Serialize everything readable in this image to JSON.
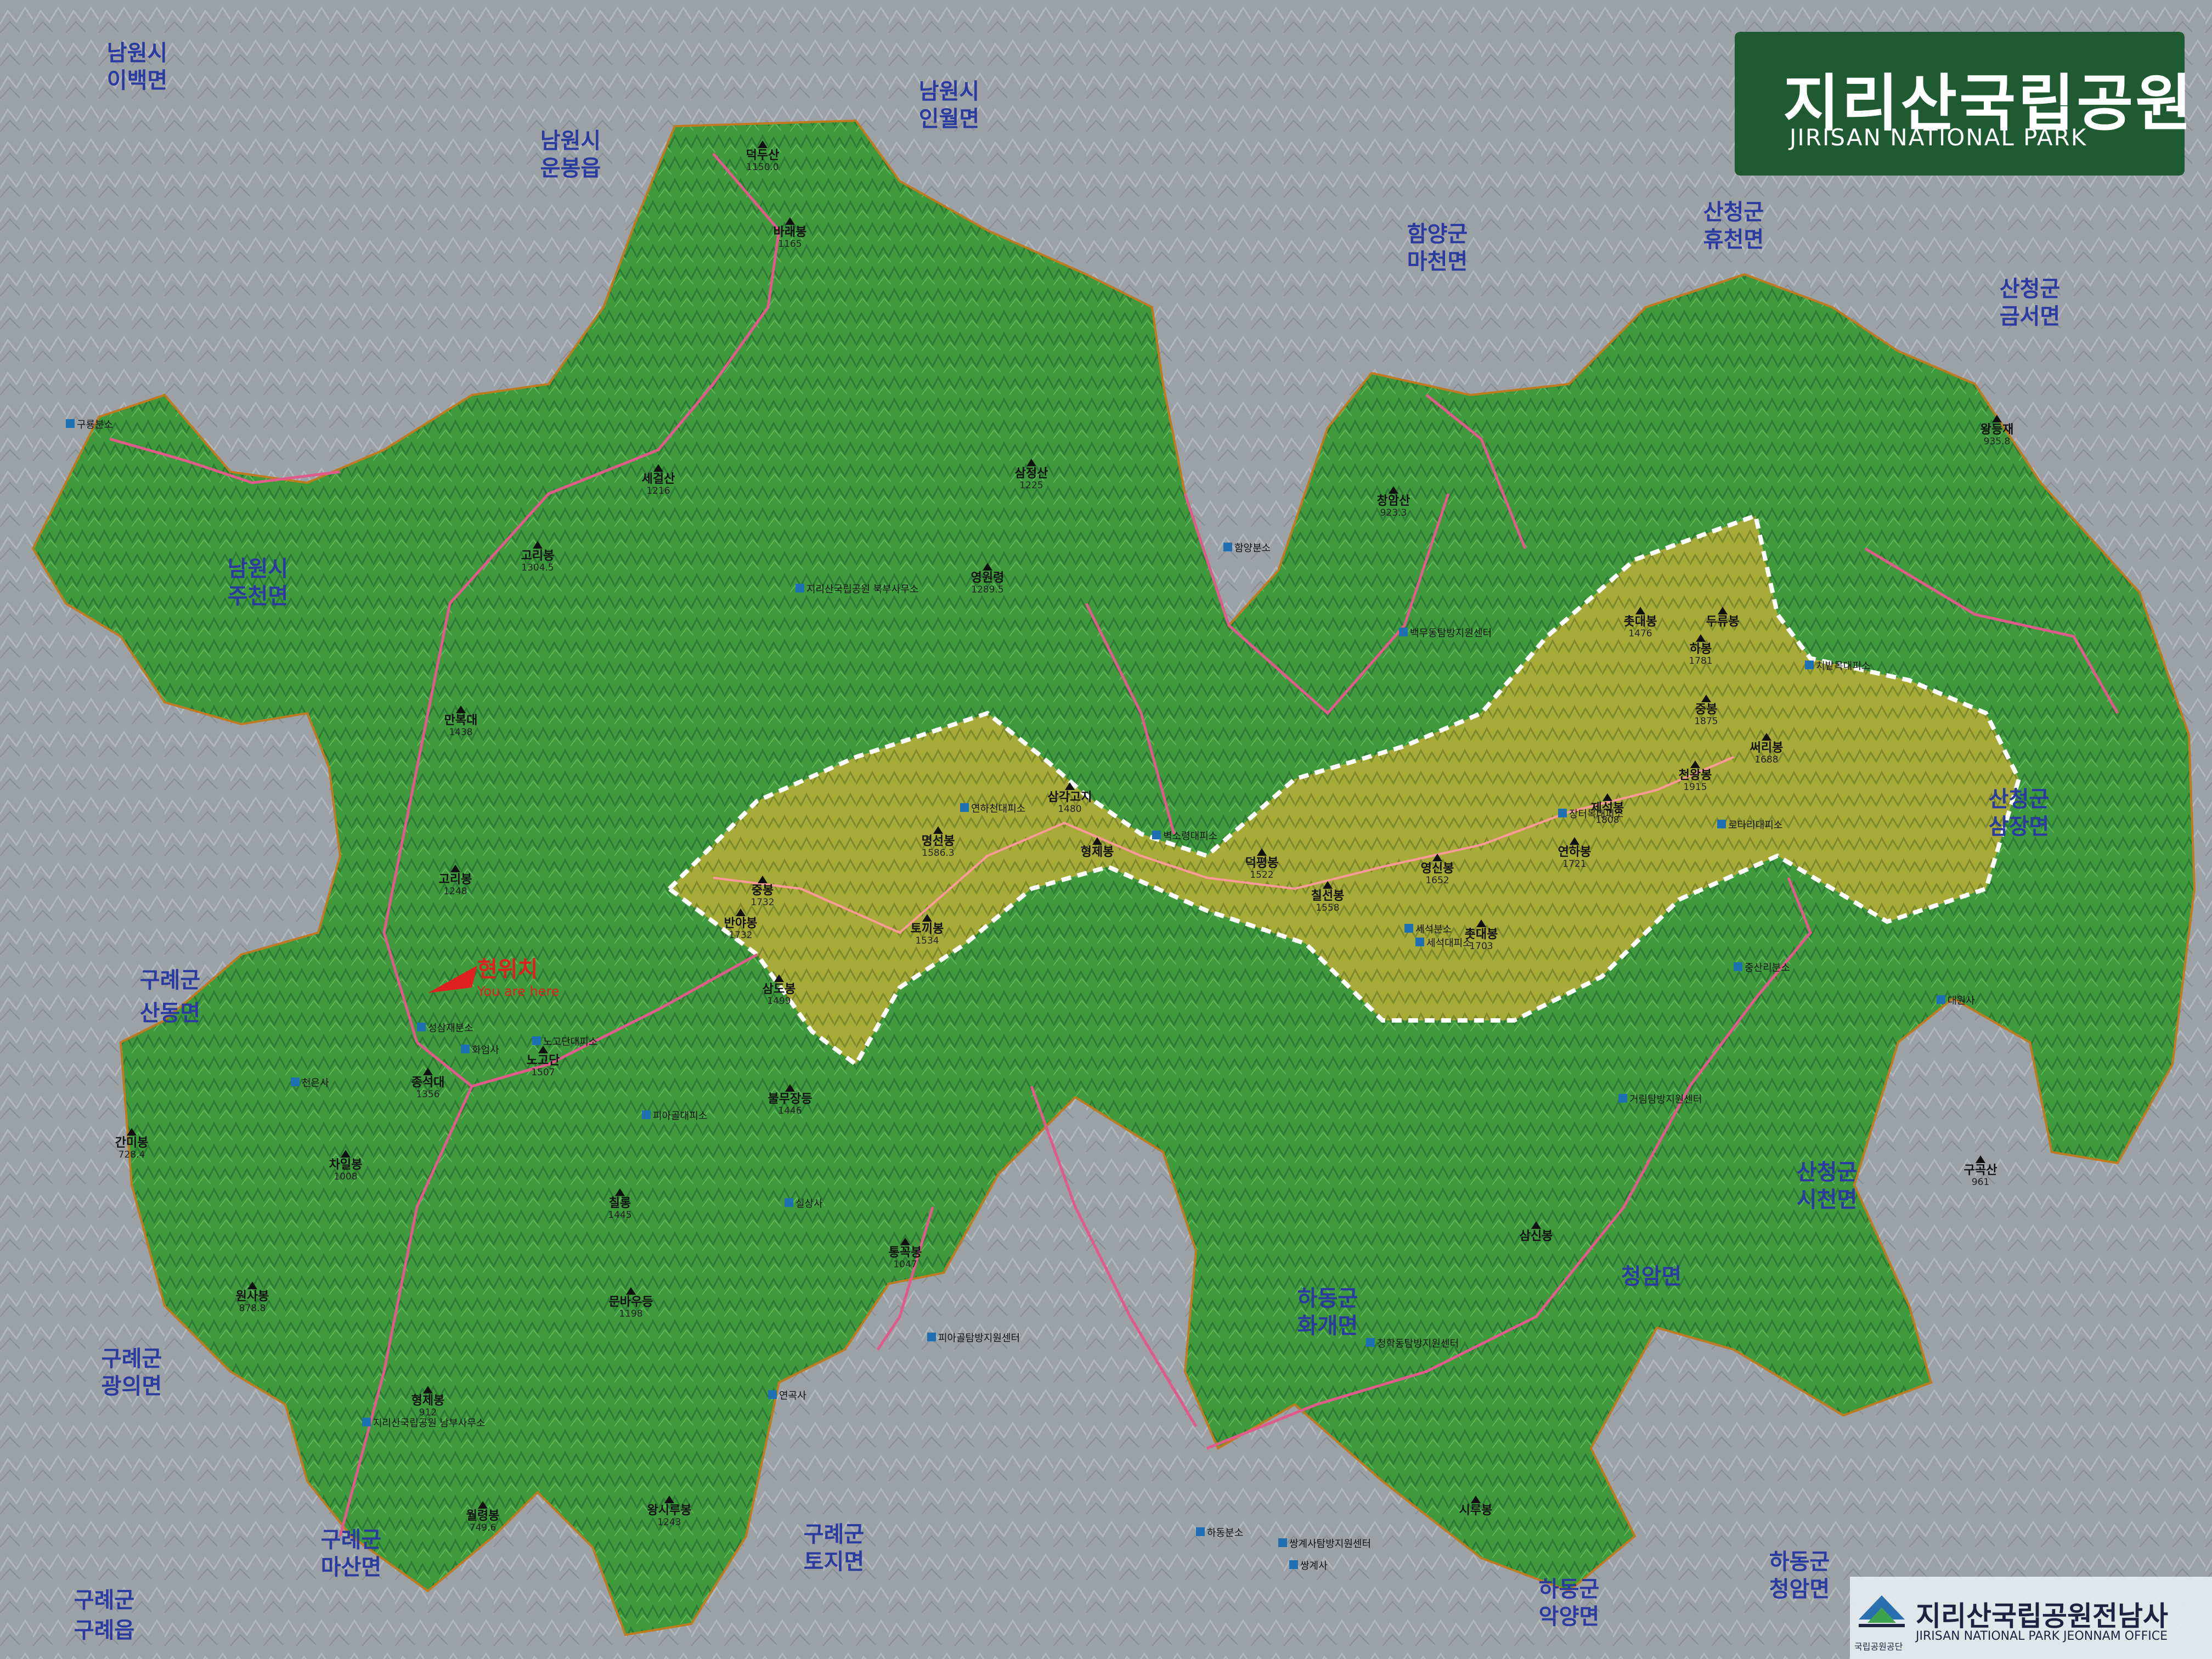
{
  "title": {
    "ko": "지리산국립공원",
    "en": "JIRISAN NATIONAL PARK"
  },
  "you_are_here": {
    "ko": "현위치",
    "en": "You are here"
  },
  "footer": {
    "agency": "국립공원공단",
    "office_ko": "지리산국립공원전남사",
    "office_en": "JIRISAN NATIONAL PARK JEONNAM OFFICE"
  },
  "regions": [
    {
      "city": "남원시",
      "town": "이백면"
    },
    {
      "city": "남원시",
      "town": "인월면"
    },
    {
      "city": "남원시",
      "town": "운봉읍"
    },
    {
      "city": "남원시",
      "town": "주천면"
    },
    {
      "city": "함양군",
      "town": "마천면"
    },
    {
      "city": "산청군",
      "town": "휴천면"
    },
    {
      "city": "산청군",
      "town": "금서면"
    },
    {
      "city": "산청군",
      "town": "삼장면"
    },
    {
      "city": "산청군",
      "town": "시천면"
    },
    {
      "city": "구례군",
      "town": "산동면"
    },
    {
      "city": "구례군",
      "town": "광의면"
    },
    {
      "city": "구례군",
      "town": "마산면"
    },
    {
      "city": "구례군",
      "town": "토지면"
    },
    {
      "city": "구례군",
      "town": "구례읍"
    },
    {
      "city": "하동군",
      "town": "화개면"
    },
    {
      "city": "하동군",
      "town": "악양면"
    },
    {
      "city": "하동군",
      "town": "청암면"
    },
    {
      "city": "",
      "town": "청암면"
    }
  ],
  "peaks": [
    {
      "name": "덕두산",
      "elev": "1150.0"
    },
    {
      "name": "바래봉",
      "elev": "1165"
    },
    {
      "name": "세걸산",
      "elev": "1216"
    },
    {
      "name": "고리봉",
      "elev": "1304.5"
    },
    {
      "name": "만복대",
      "elev": "1438"
    },
    {
      "name": "고리봉",
      "elev": "1248"
    },
    {
      "name": "삼정산",
      "elev": "1225"
    },
    {
      "name": "영원령",
      "elev": "1289.5"
    },
    {
      "name": "창암산",
      "elev": "923.3"
    },
    {
      "name": "왕등재",
      "elev": "935.8"
    },
    {
      "name": "촛대봉",
      "elev": "1476"
    },
    {
      "name": "두류봉",
      "elev": ""
    },
    {
      "name": "하봉",
      "elev": "1781"
    },
    {
      "name": "중봉",
      "elev": "1875"
    },
    {
      "name": "써리봉",
      "elev": "1688"
    },
    {
      "name": "천왕봉",
      "elev": "1915"
    },
    {
      "name": "제석봉",
      "elev": "1808"
    },
    {
      "name": "연하봉",
      "elev": "1721"
    },
    {
      "name": "영신봉",
      "elev": "1652"
    },
    {
      "name": "칠선봉",
      "elev": "1558"
    },
    {
      "name": "촛대봉",
      "elev": "1703"
    },
    {
      "name": "덕평봉",
      "elev": "1522"
    },
    {
      "name": "형제봉",
      "elev": ""
    },
    {
      "name": "삼각고지",
      "elev": "1480"
    },
    {
      "name": "명선봉",
      "elev": "1586.3"
    },
    {
      "name": "토끼봉",
      "elev": "1534"
    },
    {
      "name": "중봉",
      "elev": "1732"
    },
    {
      "name": "반야봉",
      "elev": "1732"
    },
    {
      "name": "삼도봉",
      "elev": "1499"
    },
    {
      "name": "노고단",
      "elev": "1507"
    },
    {
      "name": "종석대",
      "elev": "1356"
    },
    {
      "name": "간미봉",
      "elev": "728.4"
    },
    {
      "name": "차일봉",
      "elev": "1008"
    },
    {
      "name": "원사봉",
      "elev": "878.8"
    },
    {
      "name": "형제봉",
      "elev": "912"
    },
    {
      "name": "월령봉",
      "elev": "749.6"
    },
    {
      "name": "왕시루봉",
      "elev": "1243"
    },
    {
      "name": "불무장등",
      "elev": "1446"
    },
    {
      "name": "칠롱",
      "elev": "1445"
    },
    {
      "name": "문바우등",
      "elev": "1198"
    },
    {
      "name": "통꼭봉",
      "elev": "1047"
    },
    {
      "name": "삼신봉",
      "elev": ""
    },
    {
      "name": "시루봉",
      "elev": ""
    },
    {
      "name": "구곡산",
      "elev": "961"
    }
  ],
  "facilities": [
    {
      "name": "함양분소"
    },
    {
      "name": "지리산국립공원 북부사무소"
    },
    {
      "name": "세석분소"
    },
    {
      "name": "성삼재분소"
    },
    {
      "name": "노고단대피소"
    },
    {
      "name": "피아골대피소"
    },
    {
      "name": "연하천대피소"
    },
    {
      "name": "벽소령대피소"
    },
    {
      "name": "세석대피소"
    },
    {
      "name": "장터목대피소"
    },
    {
      "name": "로타리대피소"
    },
    {
      "name": "치밭목대피소"
    },
    {
      "name": "중산리분소"
    },
    {
      "name": "거림탐방지원센터"
    },
    {
      "name": "쌍계사탐방지원센터"
    },
    {
      "name": "하동분소"
    },
    {
      "name": "피아골탐방지원센터"
    },
    {
      "name": "지리산국립공원 남부사무소"
    },
    {
      "name": "구룡분소"
    },
    {
      "name": "백무동탐방지원센터"
    },
    {
      "name": "청학동탐방지원센터"
    },
    {
      "name": "대원사"
    },
    {
      "name": "실상사"
    },
    {
      "name": "쌍계사"
    },
    {
      "name": "화엄사"
    },
    {
      "name": "천은사"
    },
    {
      "name": "연곡사"
    }
  ],
  "colors": {
    "map_bg": "#8c9196",
    "forest": "#3f9a3e",
    "forest_dark": "#2c7a33",
    "subalpine": "#a8aa3a",
    "road": "#e05a8a",
    "region_text": "#2a3aa0",
    "title_bg": "#1f5a32",
    "you_are_here": "#e02020"
  }
}
